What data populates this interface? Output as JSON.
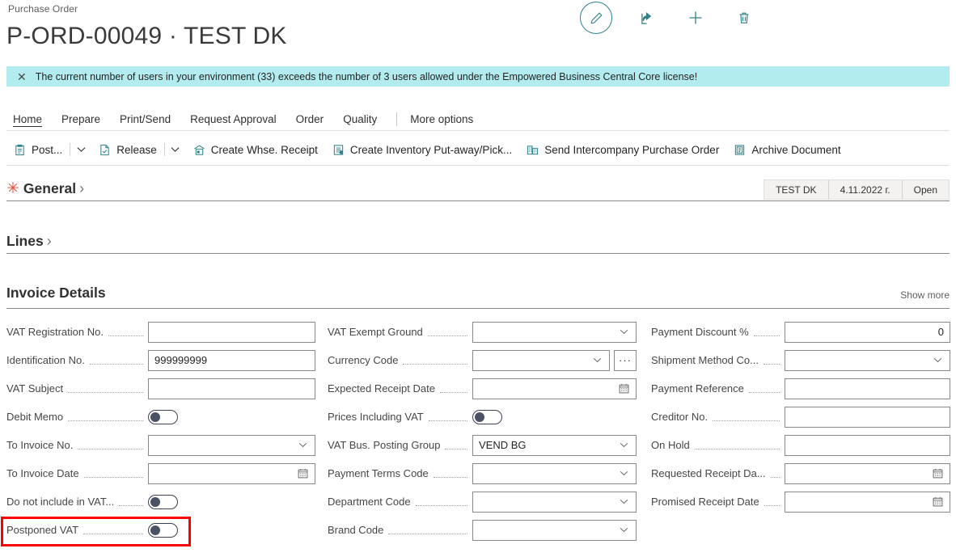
{
  "breadcrumb": "Purchase Order",
  "page_title": "P-ORD-00049 · TEST DK",
  "colors": {
    "accent_teal": "#2e8289",
    "notification_bg": "#b3ecef",
    "required_star": "#e8443a",
    "highlight_box": "#ff0000"
  },
  "top_actions": [
    {
      "name": "edit-pencil-icon",
      "label": "Edit"
    },
    {
      "name": "share-icon",
      "label": "Share"
    },
    {
      "name": "plus-icon",
      "label": "New"
    },
    {
      "name": "trash-icon",
      "label": "Delete"
    }
  ],
  "notification": {
    "close_label": "✕",
    "message": "The current number of users in your environment (33) exceeds the number of 3 users allowed under the Empowered Business Central Core license!"
  },
  "ribbon": {
    "tabs": [
      {
        "label": "Home",
        "active": true
      },
      {
        "label": "Prepare",
        "active": false
      },
      {
        "label": "Print/Send",
        "active": false
      },
      {
        "label": "Request Approval",
        "active": false
      },
      {
        "label": "Order",
        "active": false
      },
      {
        "label": "Quality",
        "active": false
      }
    ],
    "more_options": "More options",
    "commands": [
      {
        "label": "Post...",
        "icon": "post-icon",
        "split": true
      },
      {
        "label": "Release",
        "icon": "release-icon",
        "split": true
      },
      {
        "label": "Create Whse. Receipt",
        "icon": "warehouse-receipt-icon",
        "split": false
      },
      {
        "label": "Create Inventory Put-away/Pick...",
        "icon": "inventory-putaway-icon",
        "split": false
      },
      {
        "label": "Send Intercompany Purchase Order",
        "icon": "intercompany-icon",
        "split": false
      },
      {
        "label": "Archive Document",
        "icon": "archive-icon",
        "split": false
      }
    ]
  },
  "sections": {
    "general": {
      "title": "General",
      "required": true,
      "chevron": "›",
      "pills": [
        "TEST DK",
        "4.11.2022 г.",
        "Open"
      ]
    },
    "lines": {
      "title": "Lines",
      "chevron": "›"
    },
    "invoice_details": {
      "title": "Invoice Details",
      "show_more": "Show more"
    }
  },
  "fields": {
    "column_left": [
      {
        "label": "VAT Registration No.",
        "type": "text",
        "value": ""
      },
      {
        "label": "Identification No.",
        "type": "text",
        "value": "999999999"
      },
      {
        "label": "VAT Subject",
        "type": "text",
        "value": ""
      },
      {
        "label": "Debit Memo",
        "type": "toggle",
        "value": "off"
      },
      {
        "label": "To Invoice No.",
        "type": "dropdown",
        "value": ""
      },
      {
        "label": "To Invoice Date",
        "type": "date",
        "value": ""
      },
      {
        "label": "Do not include in VAT...",
        "type": "toggle",
        "value": "off"
      },
      {
        "label": "Postponed VAT",
        "type": "toggle",
        "value": "off",
        "highlighted": true
      }
    ],
    "column_middle": [
      {
        "label": "VAT Exempt Ground",
        "type": "dropdown",
        "value": ""
      },
      {
        "label": "Currency Code",
        "type": "dropdown-lookup",
        "value": "",
        "lookup_label": "···"
      },
      {
        "label": "Expected Receipt Date",
        "type": "date",
        "value": ""
      },
      {
        "label": "Prices Including VAT",
        "type": "toggle",
        "value": "off"
      },
      {
        "label": "VAT Bus. Posting Group",
        "type": "dropdown",
        "value": "VEND BG"
      },
      {
        "label": "Payment Terms Code",
        "type": "dropdown",
        "value": ""
      },
      {
        "label": "Department Code",
        "type": "dropdown",
        "value": ""
      },
      {
        "label": "Brand Code",
        "type": "dropdown",
        "value": ""
      }
    ],
    "column_right": [
      {
        "label": "Payment Discount %",
        "type": "number",
        "value": "0"
      },
      {
        "label": "Shipment Method Co...",
        "type": "dropdown",
        "value": ""
      },
      {
        "label": "Payment Reference",
        "type": "text",
        "value": ""
      },
      {
        "label": "Creditor No.",
        "type": "text",
        "value": ""
      },
      {
        "label": "On Hold",
        "type": "text",
        "value": ""
      },
      {
        "label": "Requested Receipt Da...",
        "type": "date",
        "value": ""
      },
      {
        "label": "Promised Receipt Date",
        "type": "date",
        "value": ""
      }
    ]
  }
}
